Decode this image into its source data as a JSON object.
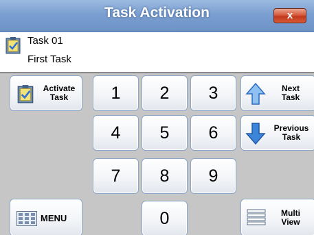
{
  "window": {
    "title": "Task Activation",
    "close_label": "x"
  },
  "task": {
    "id": "Task 01",
    "description": "First Task"
  },
  "buttons": {
    "activate": [
      "Activate",
      "Task"
    ],
    "next": [
      "Next",
      "Task"
    ],
    "previous": [
      "Previous",
      "Task"
    ],
    "menu": "MENU",
    "multi": [
      "Multi",
      "View"
    ]
  },
  "digits": [
    "1",
    "2",
    "3",
    "4",
    "5",
    "6",
    "7",
    "8",
    "9",
    "0"
  ],
  "icons": {
    "task": "task-clipboard-icon",
    "up": "arrow-up-icon",
    "down": "arrow-down-icon",
    "menu": "menu-grid-icon",
    "multi": "list-lines-icon"
  },
  "colors": {
    "titlebar": "#7b9fd0",
    "close": "#d65b3d",
    "arrow": "#3d85d8",
    "keypad_bg": "#c6c6c6"
  }
}
